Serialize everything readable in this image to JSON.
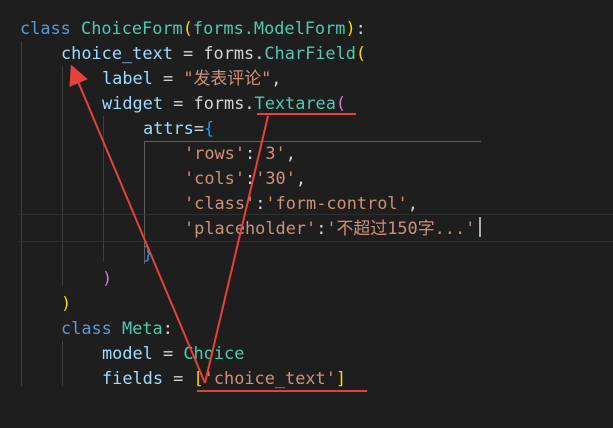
{
  "code": {
    "l1": {
      "kw": "class",
      "name": "ChoiceForm",
      "p1": "(",
      "base": "forms.ModelForm",
      "p2": ")",
      "colon": ":"
    },
    "l2": {
      "var": "choice_text",
      "eq": " = ",
      "obj": "forms.",
      "fn": "CharField",
      "p": "("
    },
    "l3": {
      "var": "label",
      "eq": " = ",
      "str": "\"发表评论\"",
      "comma": ","
    },
    "l4": {
      "var": "widget",
      "eq": " = ",
      "obj": "forms.",
      "fn": "Textarea",
      "p": "("
    },
    "l5": {
      "var": "attrs",
      "eq": "=",
      "brace": "{"
    },
    "l6": {
      "key": "'rows'",
      "colon": ":",
      "val": "'3'",
      "comma": ","
    },
    "l7": {
      "key": "'cols'",
      "colon": ":",
      "val": "'30'",
      "comma": ","
    },
    "l8": {
      "key": "'class'",
      "colon": ":",
      "val": "'form-control'",
      "comma": ","
    },
    "l9": {
      "key": "'placeholder'",
      "colon": ":",
      "val": "'不超过150字...'"
    },
    "l10": {
      "brace": "}"
    },
    "l11": {
      "p": ")"
    },
    "l12": {
      "p": ")"
    },
    "l13": {
      "kw": "class",
      "name": "Meta",
      "colon": ":"
    },
    "l14": {
      "var": "model",
      "eq": " = ",
      "cls": "Choice"
    },
    "l15": {
      "var": "fields",
      "eq": " = ",
      "open": "[",
      "str": "'choice_text'",
      "close": "]"
    }
  },
  "colors": {
    "background": "#1e1e1e",
    "annotation": "#e8413a"
  }
}
